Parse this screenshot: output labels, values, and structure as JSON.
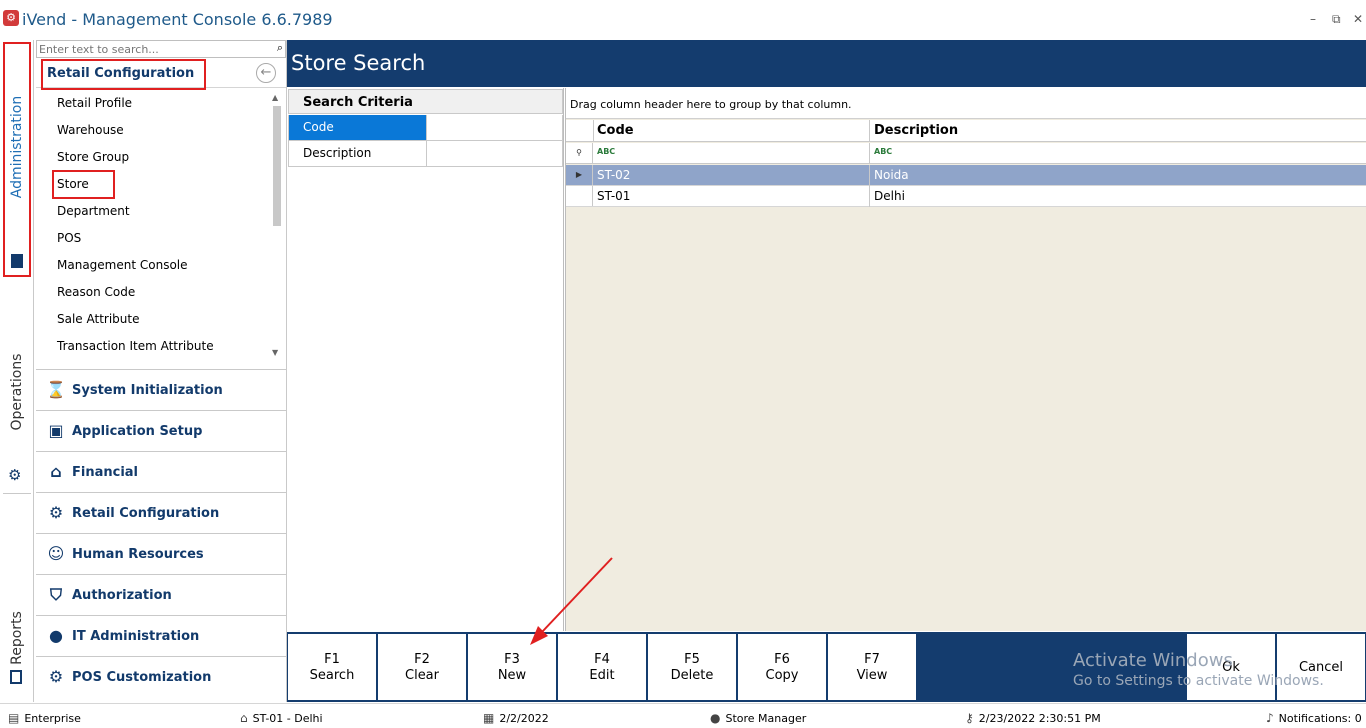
{
  "app": {
    "title": "iVend - Management Console  6.6.7989"
  },
  "window_controls": {
    "minimize": "–",
    "restore": "⧉",
    "close": "✕"
  },
  "side_tabs": [
    {
      "label": "Administration",
      "icon": "admin-icon"
    },
    {
      "label": "Operations",
      "icon": "gear-icon"
    },
    {
      "label": "Reports",
      "icon": "report-icon"
    }
  ],
  "nav": {
    "search_placeholder": "Enter text to search...",
    "group_title": "Retail Configuration",
    "items": [
      "Retail Profile",
      "Warehouse",
      "Store Group",
      "Store",
      "Department",
      "POS",
      "Management Console",
      "Reason Code",
      "Sale Attribute",
      "Transaction Item Attribute"
    ],
    "sections": [
      {
        "label": "System Initialization",
        "icon": "hourglass-icon"
      },
      {
        "label": "Application Setup",
        "icon": "terminal-icon"
      },
      {
        "label": "Financial",
        "icon": "bank-icon"
      },
      {
        "label": "Retail Configuration",
        "icon": "gears-icon"
      },
      {
        "label": "Human Resources",
        "icon": "people-icon"
      },
      {
        "label": "Authorization",
        "icon": "shield-icon"
      },
      {
        "label": "IT Administration",
        "icon": "user-admin-icon"
      },
      {
        "label": "POS Customization",
        "icon": "pos-gear-icon"
      }
    ]
  },
  "content": {
    "title": "Store Search",
    "criteria": {
      "header": "Search Criteria",
      "fields": [
        {
          "label": "Code",
          "value": "",
          "selected": true
        },
        {
          "label": "Description",
          "value": "",
          "selected": false
        }
      ]
    },
    "grid": {
      "group_hint": "Drag column header here to group by that column.",
      "columns": [
        "Code",
        "Description"
      ],
      "filter_glyph": "ABC",
      "rows": [
        {
          "code": "ST-02",
          "description": "Noida",
          "selected": true
        },
        {
          "code": "ST-01",
          "description": "Delhi",
          "selected": false
        }
      ]
    }
  },
  "toolbar": {
    "keys": [
      {
        "key": "F1",
        "label": "Search"
      },
      {
        "key": "F2",
        "label": "Clear"
      },
      {
        "key": "F3",
        "label": "New"
      },
      {
        "key": "F4",
        "label": "Edit"
      },
      {
        "key": "F5",
        "label": "Delete"
      },
      {
        "key": "F6",
        "label": "Copy"
      },
      {
        "key": "F7",
        "label": "View"
      }
    ],
    "ok": "Ok",
    "cancel": "Cancel"
  },
  "watermark": {
    "line1": "Activate Windows",
    "line2": "Go to Settings to activate Windows."
  },
  "status": {
    "company": "Enterprise",
    "store": "ST-01 - Delhi",
    "date": "2/2/2022",
    "user": "Store Manager",
    "login_time": "2/23/2022 2:30:51 PM",
    "notifications": "Notifications: 0"
  },
  "colors": {
    "header_blue": "#143c6e",
    "selection_blue": "#0a78d7",
    "highlight_red": "#e02020"
  }
}
